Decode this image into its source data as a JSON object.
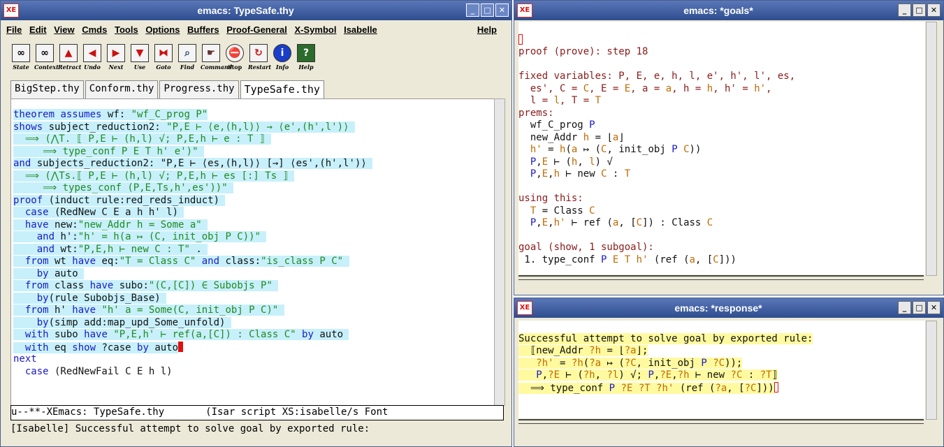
{
  "main": {
    "title": "emacs: TypeSafe.thy",
    "menu": [
      "File",
      "Edit",
      "View",
      "Cmds",
      "Tools",
      "Options",
      "Buffers",
      "Proof-General",
      "X-Symbol",
      "Isabelle"
    ],
    "help": "Help",
    "toolbar": [
      {
        "label": "State",
        "icon": "∞"
      },
      {
        "label": "Context",
        "icon": "∞"
      },
      {
        "label": "Retract",
        "icon": "▲"
      },
      {
        "label": "Undo",
        "icon": "◀"
      },
      {
        "label": "Next",
        "icon": "▶"
      },
      {
        "label": "Use",
        "icon": "▼"
      },
      {
        "label": "Goto",
        "icon": "⧓"
      },
      {
        "label": "Find",
        "icon": "⌕"
      },
      {
        "label": "Command",
        "icon": "☛"
      },
      {
        "label": "Stop",
        "icon": "⛔"
      },
      {
        "label": "Restart",
        "icon": "↻"
      },
      {
        "label": "Info",
        "icon": "i"
      },
      {
        "label": "Help",
        "icon": "?"
      }
    ],
    "tabs": [
      "BigStep.thy",
      "Conform.thy",
      "Progress.thy",
      "TypeSafe.thy"
    ],
    "modeline": "u--**-XEmacs: TypeSafe.thy       (Isar script XS:isabelle/s Font",
    "echo": "[Isabelle] Successful attempt to solve goal by exported rule:"
  },
  "goals": {
    "title": "emacs: *goals*",
    "step": "proof (prove): step 18"
  },
  "response": {
    "title": "emacs: *response*",
    "first": "Successful attempt to solve goal by exported rule:"
  }
}
